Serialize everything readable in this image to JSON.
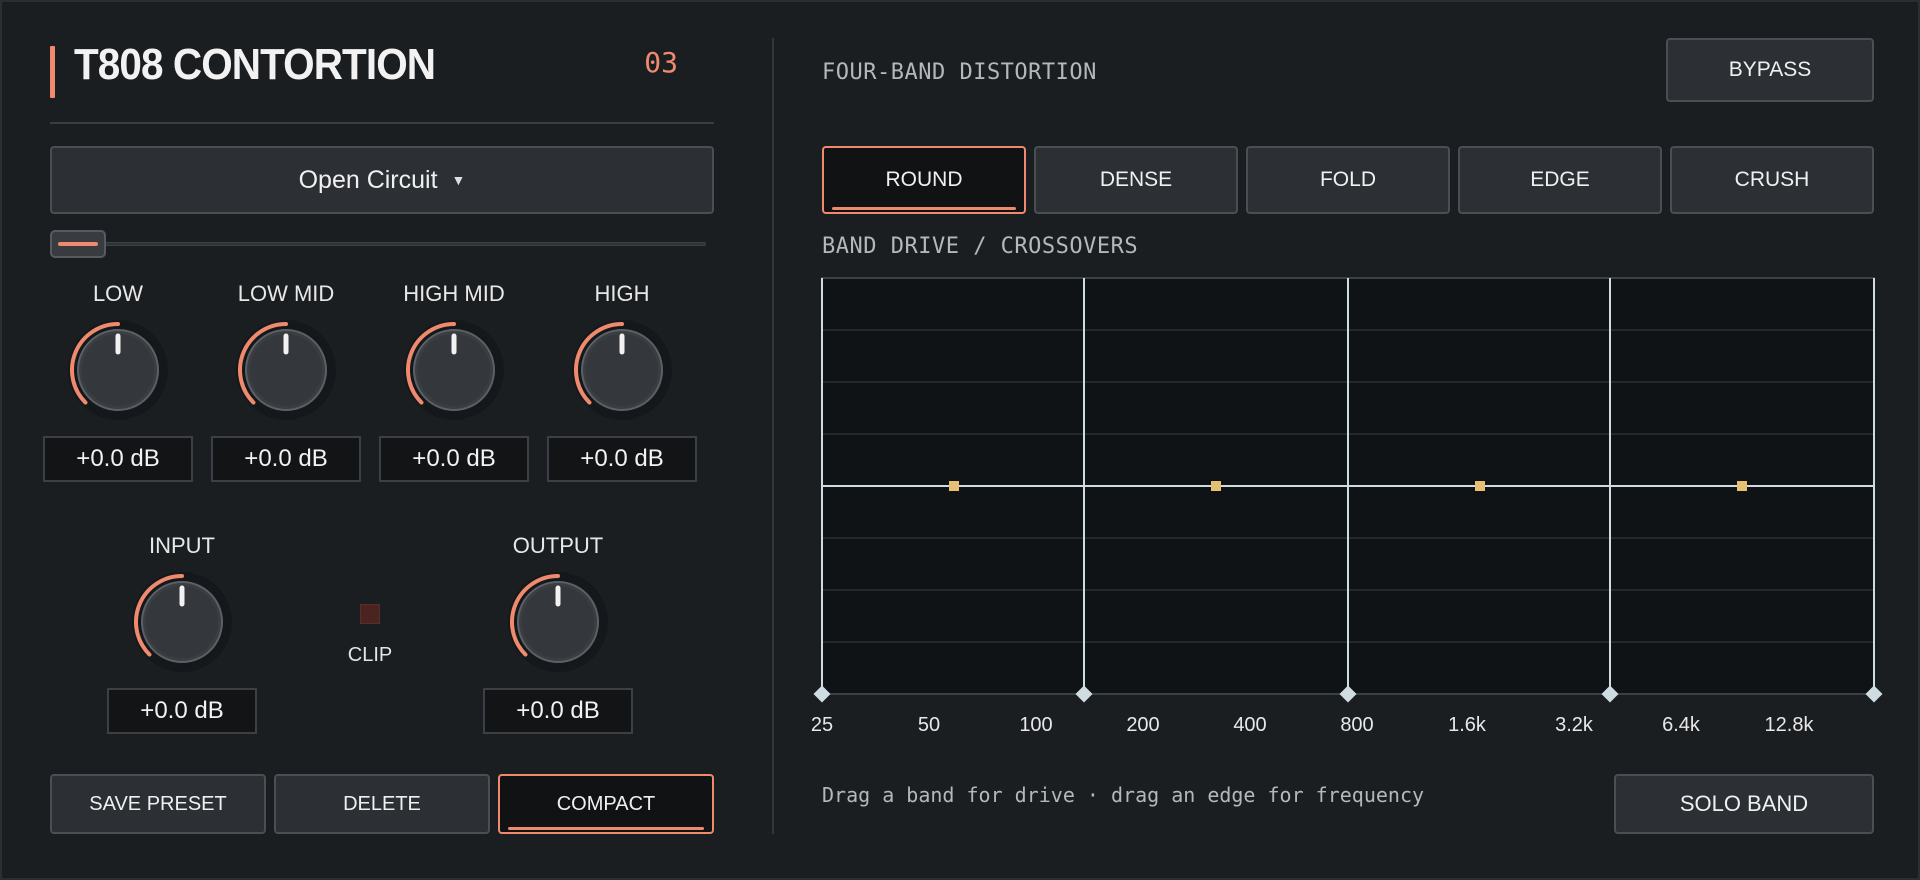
{
  "header": {
    "title": "T808 CONTORTION",
    "preset_number": "03"
  },
  "preset": {
    "name": "Open Circuit",
    "caret_icon": "caret-down-icon"
  },
  "bands": [
    {
      "label": "LOW",
      "value": "+0.0 dB"
    },
    {
      "label": "LOW MID",
      "value": "+0.0 dB"
    },
    {
      "label": "HIGH MID",
      "value": "+0.0 dB"
    },
    {
      "label": "HIGH",
      "value": "+0.0 dB"
    }
  ],
  "io": {
    "input": {
      "label": "INPUT",
      "value": "+0.0 dB"
    },
    "output": {
      "label": "OUTPUT",
      "value": "+0.0 dB"
    },
    "clip_label": "CLIP"
  },
  "buttons": {
    "save": "SAVE PRESET",
    "delete": "DELETE",
    "compact": "COMPACT",
    "bypass": "BYPASS",
    "solo": "SOLO BAND"
  },
  "distortion": {
    "section_title": "FOUR-BAND DISTORTION",
    "modes": [
      "ROUND",
      "DENSE",
      "FOLD",
      "EDGE",
      "CRUSH"
    ],
    "active_mode": "ROUND"
  },
  "graph": {
    "title": "BAND DRIVE / CROSSOVERS",
    "freq_labels": [
      "25",
      "50",
      "100",
      "200",
      "400",
      "800",
      "1.6k",
      "3.2k",
      "6.4k",
      "12.8k"
    ],
    "hint": "Drag a band for drive · drag an edge for frequency"
  },
  "colors": {
    "accent": "#f08a6e",
    "band_marker": "#e8c074",
    "grid_line": "#cfdde2",
    "panel_bg": "#1b1e21",
    "graph_bg": "#101315"
  }
}
